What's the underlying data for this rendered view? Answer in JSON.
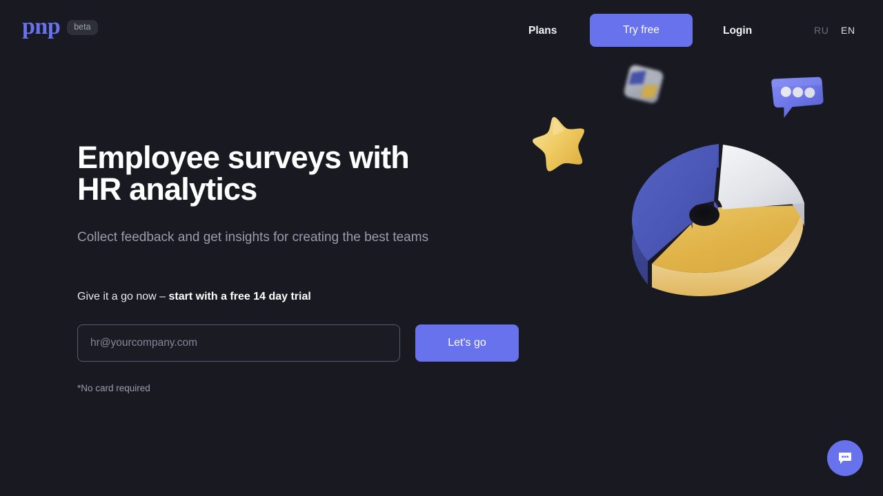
{
  "page": {
    "background_color": "#191a21",
    "accent_color": "#6872ec"
  },
  "header": {
    "logo_text": "pnp",
    "logo_color": "#6872ec",
    "beta_badge": "beta",
    "nav": {
      "plans": "Plans",
      "try_free": "Try free",
      "login": "Login"
    },
    "language": {
      "ru": "RU",
      "en": "EN",
      "selected": "EN"
    }
  },
  "hero": {
    "title": "Employee surveys with HR analytics",
    "subtitle": "Collect feedback and get insights for creating the best teams",
    "cta_prefix": "Give it a go now – ",
    "cta_bold": "start with a free 14 day trial",
    "email_placeholder": "hr@yourcompany.com",
    "email_value": "",
    "submit_label": "Let's go",
    "footnote": "*No card required"
  },
  "chat": {
    "label": "chat-bubble-icon"
  },
  "decorations": {
    "star": "3d-star",
    "speech_bubble": "3d-speech-bubble",
    "cube": "3d-blurred-cube"
  },
  "chart_data": {
    "type": "pie",
    "title": "",
    "style": "3d-donut",
    "categories": [
      "Blue segment",
      "White segment",
      "Yellow segment"
    ],
    "values": [
      45,
      20,
      35
    ],
    "colors": [
      "#4b57b5",
      "#e6e8ec",
      "#e3b94f"
    ],
    "legend": "none",
    "grid": false
  }
}
